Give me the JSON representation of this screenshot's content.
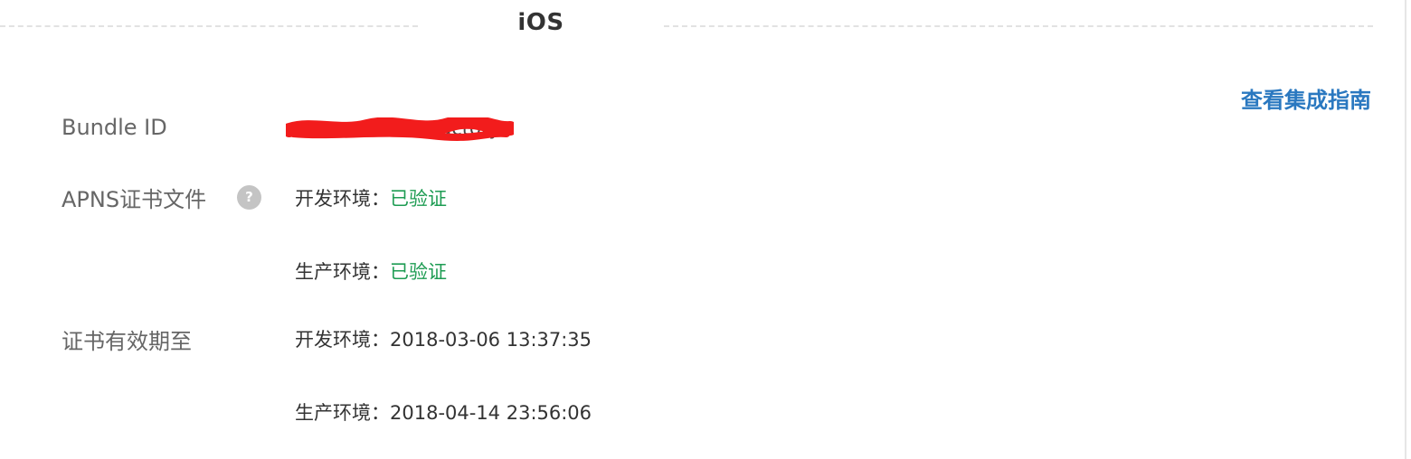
{
  "section": {
    "title": "iOS"
  },
  "header": {
    "guide_link": "查看集成指南"
  },
  "bundle": {
    "label": "Bundle ID",
    "value_visible_fragment": "charactory"
  },
  "apns": {
    "label": "APNS证书文件",
    "help_icon_symbol": "?",
    "dev_label": "开发环境：",
    "dev_status": "已验证",
    "prod_label": "生产环境：",
    "prod_status": "已验证"
  },
  "expiry": {
    "label": "证书有效期至",
    "dev_label": "开发环境：",
    "dev_value": "2018-03-06 13:37:35",
    "prod_label": "生产环境：",
    "prod_value": "2018-04-14 23:56:06"
  },
  "colors": {
    "link": "#2a78c0",
    "status_ok": "#1e9c53",
    "label_text": "#666666",
    "redaction": "#f21c1c"
  }
}
